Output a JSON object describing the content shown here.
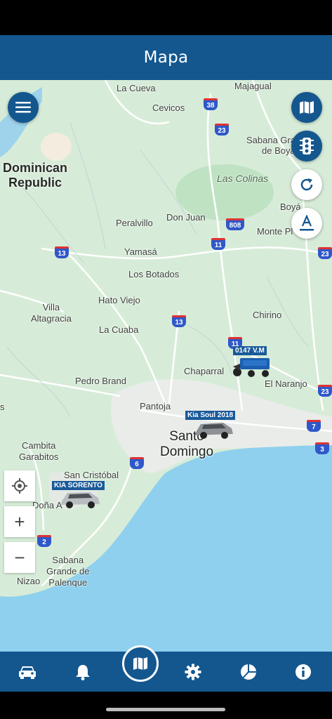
{
  "header": {
    "title": "Mapa"
  },
  "map": {
    "labels": {
      "la_cueva": "La Cueva",
      "majagual": "Majagual",
      "cevicos": "Cevicos",
      "sabana_grande_boya": "Sabana Grande\nde Boyá",
      "dominican_republic": "Dominican\nRepublic",
      "las_colinas": "Las Colinas",
      "peralvillo": "Peralvillo",
      "don_juan": "Don Juan",
      "boya": "Boyá",
      "monte_plata": "Monte Pl",
      "yamasa": "Yamasá",
      "los_botados": "Los Botados",
      "hato_viejo": "Hato Viejo",
      "villa_altagracia": "Villa\nAltagracia",
      "la_cuaba": "La Cuaba",
      "chirino": "Chirino",
      "chaparral": "Chaparral",
      "pedro_brand": "Pedro Brand",
      "el_naranjo": "El Naranjo",
      "pantoja": "Pantoja",
      "santo_domingo": "Santo\nDomingo",
      "cambita": "Cambita\nGarabitos",
      "san_cristobal": "San Cristóbal",
      "dona_ana": "Doña A",
      "sabana_grande_palenque": "Sabana\nGrande de\nPalenque",
      "nizao": "Nizao",
      "s_edge": "s"
    },
    "shields": [
      "38",
      "23",
      "808",
      "13",
      "11",
      "13",
      "11",
      "23",
      "7",
      "3",
      "6",
      "2",
      "23"
    ],
    "vehicles": [
      {
        "label": "0147 V.M",
        "type": "motorcycle"
      },
      {
        "label": "Kia Soul 2018",
        "type": "car"
      },
      {
        "label": "KIA SORENTO",
        "type": "car"
      }
    ],
    "colors": {
      "land": "#d7ecd8",
      "water": "#8fd0ee",
      "urban": "#e9ece9",
      "road": "#ffffff",
      "accent": "#14578f"
    }
  },
  "controls": {
    "menu": "menu-icon",
    "map_type": "map-icon",
    "traffic": "traffic-light-icon",
    "refresh": "refresh-icon",
    "labels": "text-format-icon",
    "locate": "crosshair-icon",
    "zoom_in": "+",
    "zoom_out": "−"
  },
  "bottom_nav": [
    "car-icon",
    "bell-icon",
    "map-icon",
    "gear-icon",
    "pie-chart-icon",
    "info-icon"
  ]
}
